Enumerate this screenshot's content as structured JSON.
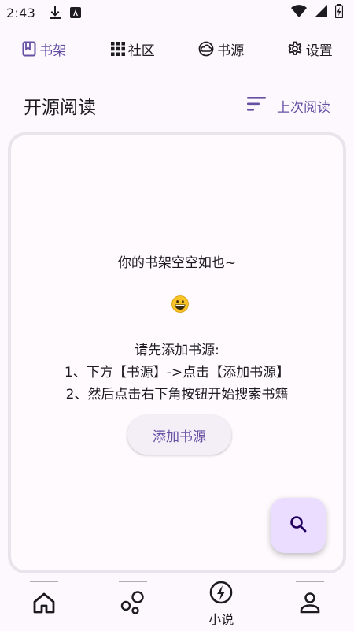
{
  "status_bar": {
    "time": "2:43"
  },
  "top_tabs": [
    {
      "label": "书架",
      "icon": "book-icon",
      "active": true
    },
    {
      "label": "社区",
      "icon": "grid-icon",
      "active": false
    },
    {
      "label": "书源",
      "icon": "cloud-icon",
      "active": false
    },
    {
      "label": "设置",
      "icon": "gear-icon",
      "active": false
    }
  ],
  "header": {
    "title": "开源阅读",
    "recent_label": "上次阅读"
  },
  "shelf": {
    "empty_message": "你的书架空空如也~",
    "emoji": "grinning-face",
    "instructions_title": "请先添加书源:",
    "instruction_1": "1、下方【书源】->点击【添加书源】",
    "instruction_2": "2、然后点击右下角按钮开始搜索书籍",
    "add_source_button": "添加书源"
  },
  "bottom_nav": {
    "items": [
      {
        "icon": "home-icon",
        "label": ""
      },
      {
        "icon": "bubbles-icon",
        "label": ""
      },
      {
        "icon": "lightning-icon",
        "label": "小说"
      },
      {
        "icon": "profile-icon",
        "label": ""
      }
    ]
  },
  "colors": {
    "accent": "#6750a4",
    "background": "#fdf8fd",
    "fab": "#eaddff",
    "card_border": "#e8e4ec"
  }
}
